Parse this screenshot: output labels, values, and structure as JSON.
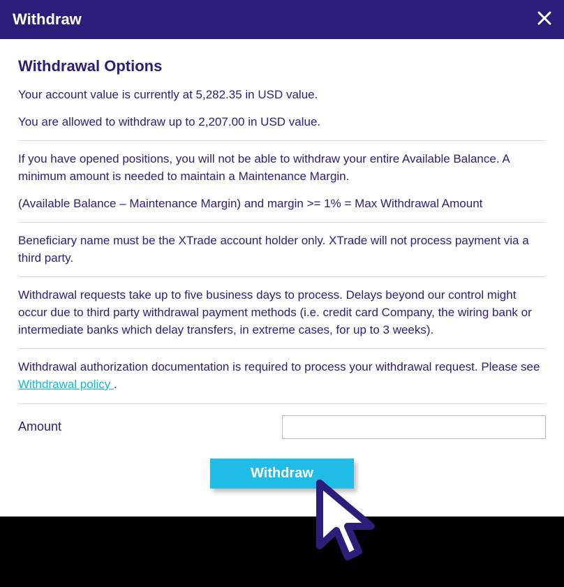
{
  "header": {
    "title": "Withdraw"
  },
  "main": {
    "heading": "Withdrawal Options",
    "account_value_line": "Your account value is currently at 5,282.35 in USD value.",
    "allowed_line": "You are allowed to withdraw up to 2,207.00 in USD value.",
    "positions_para": "If you have opened positions, you will not be able to withdraw your entire Available Balance. A minimum amount is needed to maintain a Maintenance Margin.",
    "formula_para": "(Available Balance – Maintenance Margin) and margin >= 1% = Max Withdrawal Amount",
    "beneficiary_para": "Beneficiary name must be the XTrade account holder only. XTrade will not process payment via a third party.",
    "delay_para": "Withdrawal requests take up to five business days to process. Delays beyond our control might occur due to third party withdrawal payment methods (i.e. credit card Company, the wiring bank or intermediate banks which delay transfers, in extreme cases, for up to 3 weeks).",
    "auth_prefix": "Withdrawal authorization documentation is required to process your withdrawal request. Please see ",
    "auth_link": "Withdrawal policy ",
    "auth_suffix": ".",
    "amount_label": "Amount",
    "amount_value": "",
    "submit_label": "Withdraw"
  }
}
